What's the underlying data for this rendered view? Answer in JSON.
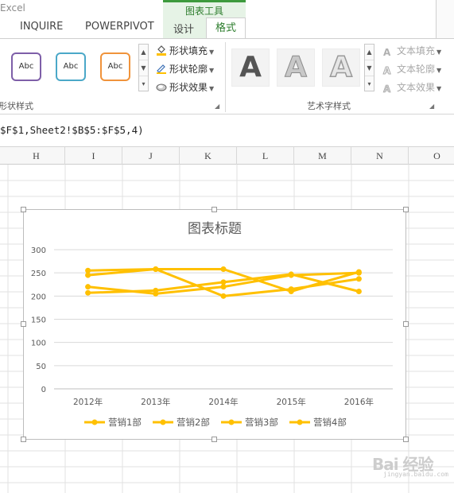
{
  "app": {
    "title": "Excel"
  },
  "ribbon": {
    "contextual_group": "图表工具",
    "tabs": [
      {
        "id": "inquire",
        "label": "INQUIRE",
        "active": false
      },
      {
        "id": "powerpivot",
        "label": "POWERPIVOT",
        "active": false
      },
      {
        "id": "design",
        "label": "设计",
        "active": false
      },
      {
        "id": "format",
        "label": "格式",
        "active": true
      }
    ],
    "shape_styles": {
      "group_label": "形状样式",
      "swatches": [
        "Abc",
        "Abc",
        "Abc"
      ],
      "swatch_colors": [
        "#7e5fa8",
        "#4ba8c8",
        "#f0933b"
      ],
      "commands": [
        {
          "label": "形状填充",
          "icon": "paint-bucket-icon"
        },
        {
          "label": "形状轮廓",
          "icon": "pencil-outline-icon"
        },
        {
          "label": "形状效果",
          "icon": "shape-effect-icon"
        }
      ]
    },
    "wordart_styles": {
      "group_label": "艺术字样式",
      "swatches": [
        "A",
        "A",
        "A"
      ],
      "commands": [
        {
          "label": "文本填充",
          "icon": "text-fill-icon"
        },
        {
          "label": "文本轮廓",
          "icon": "text-outline-icon"
        },
        {
          "label": "文本效果",
          "icon": "text-effect-icon"
        }
      ]
    }
  },
  "formula_bar": {
    "formula": "$F$1,Sheet2!$B$5:$F$5,4)"
  },
  "grid": {
    "columns": [
      "H",
      "I",
      "J",
      "K",
      "L",
      "M",
      "N",
      "O"
    ]
  },
  "chart_data": {
    "type": "line",
    "title": "图表标题",
    "categories": [
      "2012年",
      "2013年",
      "2014年",
      "2015年",
      "2016年"
    ],
    "series": [
      {
        "name": "营销1部",
        "values": [
          255,
          258,
          258,
          210,
          252
        ]
      },
      {
        "name": "营销2部",
        "values": [
          245,
          258,
          200,
          215,
          237
        ]
      },
      {
        "name": "营销3部",
        "values": [
          207,
          212,
          230,
          247,
          210
        ]
      },
      {
        "name": "营销4部",
        "values": [
          220,
          205,
          220,
          245,
          250
        ]
      }
    ],
    "yticks": [
      0,
      50,
      100,
      150,
      200,
      250,
      300
    ],
    "ylim": [
      0,
      300
    ],
    "grid": true,
    "legend_position": "bottom",
    "series_color": "#ffc000"
  },
  "watermark": {
    "text": "Bai 经验",
    "sub": "jingyan.baidu.com"
  }
}
